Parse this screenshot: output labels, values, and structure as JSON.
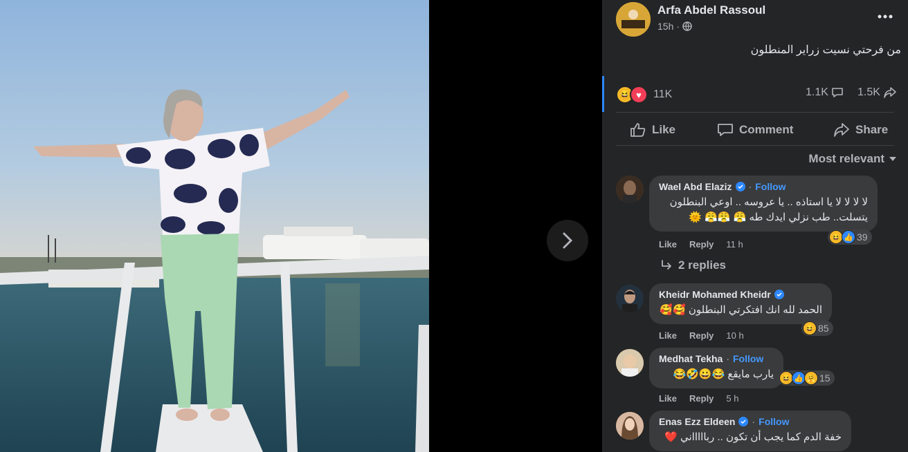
{
  "post": {
    "author": "Arfa Abdel Rassoul",
    "time": "15h",
    "caption": "من فرحتي نسيت زراير المنطلون",
    "reactions_count": "11K",
    "comments_count": "1.1K",
    "shares_count": "1.5K"
  },
  "actions": {
    "like": "Like",
    "comment": "Comment",
    "share": "Share"
  },
  "sort_label": "Most relevant",
  "comments": [
    {
      "name": "Wael Abd Elaziz",
      "verified": true,
      "follow": "Follow",
      "text_line1": "لا لا لا لا يا استاذه .. يا عروسه .. اوعي البنطلون",
      "text_line2": "يتسلت.. طب نزلي ايدك طه 😤 😤😤 🌞",
      "like": "Like",
      "reply": "Reply",
      "time": "11 h",
      "reaction_count": "39",
      "replies": "2 replies"
    },
    {
      "name": "Kheidr Mohamed Kheidr",
      "verified": true,
      "text_line1": "الحمد لله انك افتكرتي البنطلون 🥰🥰",
      "like": "Like",
      "reply": "Reply",
      "time": "10 h",
      "reaction_count": "85"
    },
    {
      "name": "Medhat Tekha",
      "verified": false,
      "follow": "Follow",
      "text_line1": "يارب مايقع 😂😀🤣😂",
      "like": "Like",
      "reply": "Reply",
      "time": "5 h",
      "reaction_count": "15"
    },
    {
      "name": "Enas Ezz Eldeen",
      "verified": true,
      "follow": "Follow",
      "text_line1": "خفة الدم كما يجب أن تكون .. رباااااني ❤️"
    }
  ],
  "colors": {
    "panel_bg": "#242526",
    "bubble_bg": "#3a3b3c",
    "accent_blue": "#2d88ff",
    "love_red": "#f33e58",
    "haha_yellow": "#f7b928"
  }
}
